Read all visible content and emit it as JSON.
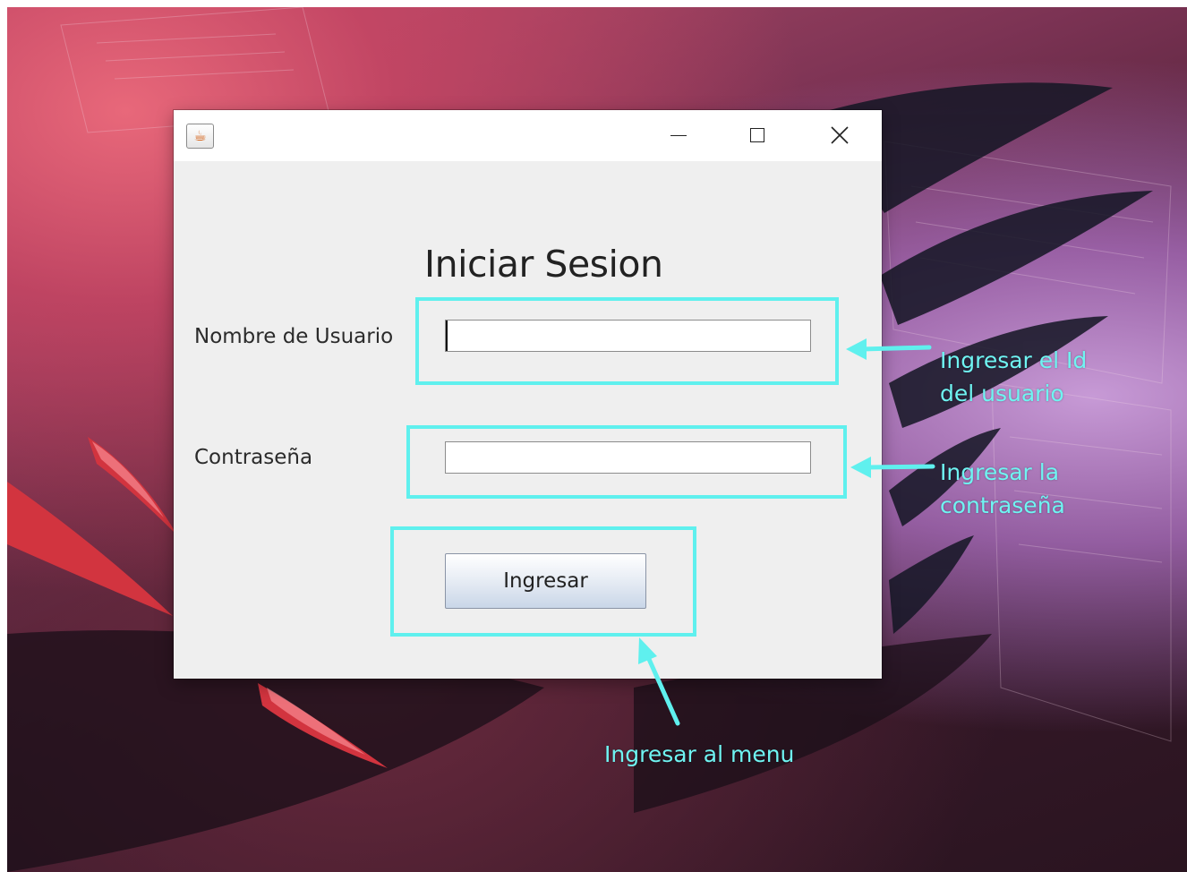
{
  "window": {
    "title": "",
    "app_icon": "java-cup-icon",
    "controls": [
      "minimize-icon",
      "maximize-icon",
      "close-icon"
    ]
  },
  "form": {
    "title": "Iniciar Sesion",
    "username_label": "Nombre de Usuario",
    "username_value": "",
    "password_label": "Contraseña",
    "password_value": "",
    "submit_label": "Ingresar"
  },
  "annotations": {
    "username_note_line1": "Ingresar el Id",
    "username_note_line2": "del usuario",
    "password_note_line1": "Ingresar la",
    "password_note_line2": "contraseña",
    "button_note": "Ingresar al menu",
    "highlight_color": "#5ff0ee"
  }
}
